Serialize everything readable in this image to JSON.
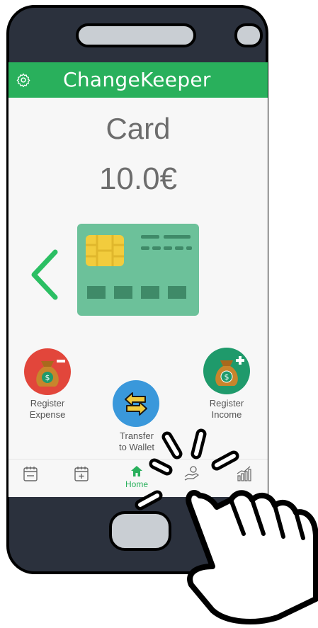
{
  "app": {
    "title": "ChangeKeeper"
  },
  "account": {
    "name": "Card",
    "balance": "10.0€"
  },
  "actions": {
    "expense_line1": "Register",
    "expense_line2": "Expense",
    "income_line1": "Register",
    "income_line2": "Income",
    "transfer_line1": "Transfer",
    "transfer_line2": "to Wallet"
  },
  "nav": {
    "home_label": "Home"
  },
  "colors": {
    "brand": "#29b05c",
    "expense": "#e2463b",
    "income": "#1f9a6b",
    "transfer": "#3a98db",
    "card": "#6cc19a",
    "chip": "#f2cc3d"
  },
  "icons": [
    "gear-icon",
    "chevron-left-icon",
    "credit-card-icon",
    "money-bag-minus-icon",
    "money-bag-plus-icon",
    "transfer-arrows-icon",
    "calendar-icon",
    "calendar-add-icon",
    "home-icon",
    "hand-coins-icon",
    "bar-chart-icon",
    "pointing-hand-icon"
  ]
}
